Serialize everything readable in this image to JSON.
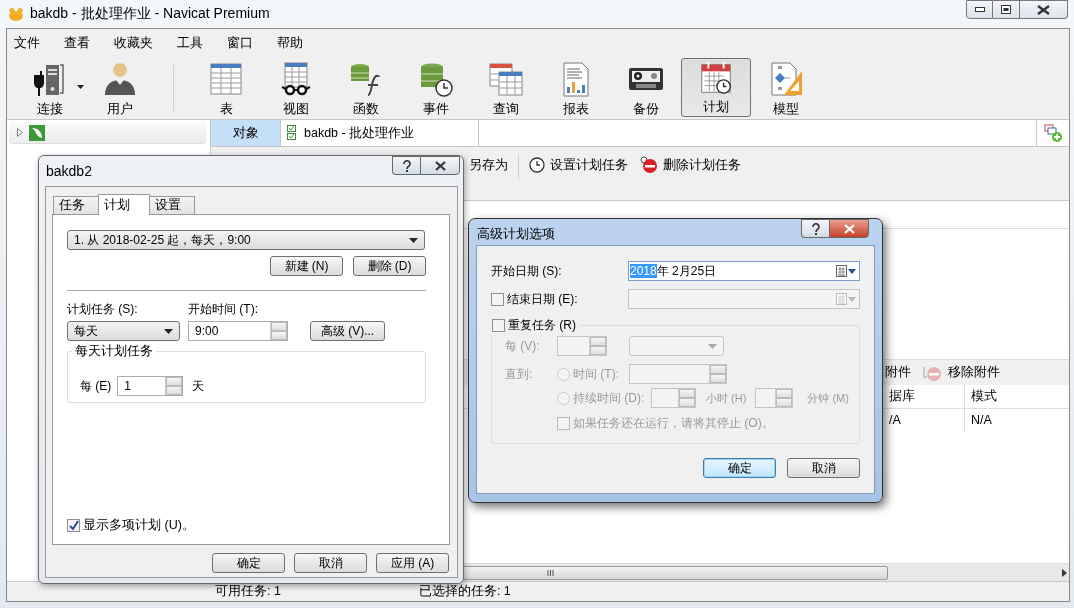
{
  "window": {
    "title": "bakdb - 批处理作业 - Navicat Premium"
  },
  "menu": [
    "文件",
    "查看",
    "收藏夹",
    "工具",
    "窗口",
    "帮助"
  ],
  "toolbar": [
    [
      {
        "label": "连接",
        "kind": "connection",
        "dropdown": true,
        "selected": false
      },
      {
        "label": "用户",
        "kind": "user",
        "selected": false
      }
    ],
    [
      {
        "label": "表",
        "kind": "table",
        "selected": false
      },
      {
        "label": "视图",
        "kind": "view",
        "selected": false
      },
      {
        "label": "函数",
        "kind": "function",
        "selected": false
      },
      {
        "label": "事件",
        "kind": "event",
        "selected": false
      },
      {
        "label": "查询",
        "kind": "query",
        "selected": false
      },
      {
        "label": "报表",
        "kind": "report",
        "selected": false
      },
      {
        "label": "备份",
        "kind": "backup",
        "selected": false
      },
      {
        "label": "计划",
        "kind": "schedule",
        "selected": true
      },
      {
        "label": "模型",
        "kind": "model",
        "selected": false
      }
    ]
  ],
  "tabs": [
    {
      "label": "对象",
      "selected": true
    },
    {
      "label": "bakdb - 批处理作业",
      "selected": false
    }
  ],
  "job_toolbar": [
    {
      "label": "另存为",
      "kind": "plain"
    },
    {
      "label": "设置计划任务",
      "kind": "clock"
    },
    {
      "label": "删除计划任务",
      "kind": "delete"
    }
  ],
  "attachment_toolbar": [
    {
      "label": "附件",
      "kind": "plain"
    },
    {
      "label": "移除附件",
      "kind": "remove"
    }
  ],
  "attachment_table": {
    "columns": [
      "据库",
      "模式"
    ],
    "rows": [
      [
        "/A",
        "N/A"
      ]
    ]
  },
  "status_bar": [
    "可用任务: 1",
    "已选择的任务: 1"
  ],
  "schedule_dialog": {
    "title": "bakdb2",
    "tabs": [
      {
        "label": "任务",
        "selected": false
      },
      {
        "label": "计划",
        "selected": true
      },
      {
        "label": "设置",
        "selected": false
      }
    ],
    "schedule_list": "1. 从 2018-02-25 起，每天，9:00",
    "list_buttons": [
      "新建 (N)",
      "删除 (D)"
    ],
    "schedule_type": {
      "label": "计划任务 (S):",
      "value": "每天"
    },
    "start_time": {
      "label": "开始时间 (T):",
      "value": "9:00"
    },
    "advanced_button": "高级 (V)...",
    "daily_group": {
      "title": "每天计划任务",
      "every_label": "每 (E)",
      "every_value": "1",
      "unit": "天"
    },
    "show_multiple": {
      "label": "显示多项计划 (U)。",
      "checked": true
    },
    "buttons": [
      "确定",
      "取消",
      "应用 (A)"
    ]
  },
  "advanced_dialog": {
    "title": "高级计划选项",
    "start_date": {
      "label": "开始日期 (S):",
      "year": "2018",
      "rest": "年  2月25日",
      "year_selected": true
    },
    "end_date": {
      "label": "结束日期 (E):",
      "checked": false
    },
    "repeat": {
      "label": "重复任务 (R)",
      "checked": false
    },
    "every_label": "每 (V):",
    "until_label": "直到:",
    "time_option": {
      "label": "时间 (T):",
      "selected": false
    },
    "duration_option": {
      "label": "持续时间 (D):",
      "selected": false
    },
    "hours_label": "小时 (H)",
    "minutes_label": "分钟 (M)",
    "stop_if_running": {
      "label": "如果任务还在运行，请将其停止 (O)。",
      "checked": false
    },
    "buttons": [
      {
        "label": "确定",
        "default": true
      },
      {
        "label": "取消",
        "default": false
      }
    ]
  }
}
